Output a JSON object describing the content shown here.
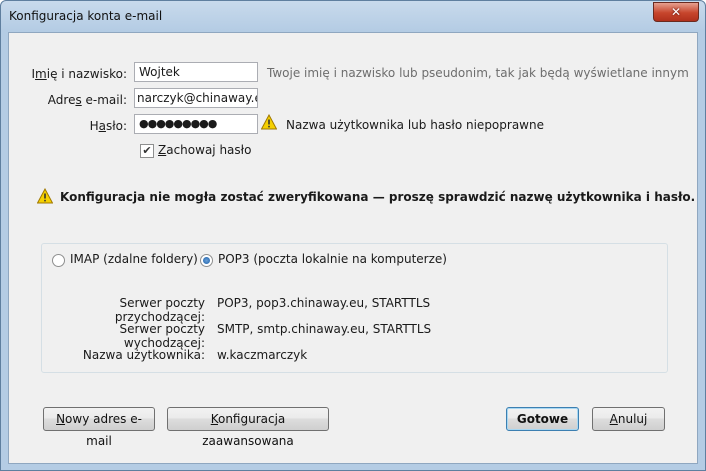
{
  "window": {
    "title": "Konfiguracja konta e-mail",
    "close_symbol": "✕"
  },
  "form": {
    "name_label_pre": "I",
    "name_label_accel": "m",
    "name_label_post": "ię i nazwisko:",
    "name_value": "Wojtek",
    "name_hint": "Twoje imię i nazwisko lub pseudonim, tak jak będą wyświetlane innym",
    "email_label_pre": "Adre",
    "email_label_accel": "s",
    "email_label_post": " e-mail:",
    "email_value": "narczyk@chinaway.eu",
    "password_label_pre": "H",
    "password_label_accel": "a",
    "password_label_post": "sło:",
    "password_value": "●●●●●●●●●",
    "password_error": "Nazwa użytkownika lub hasło niepoprawne",
    "remember_label_pre": "",
    "remember_label_accel": "Z",
    "remember_label_post": "achowaj hasło",
    "remember_checked": true,
    "checkmark": "✔"
  },
  "warning_message": "Konfiguracja nie mogła zostać zweryfikowana — proszę sprawdzić nazwę użytkownika i hasło.",
  "server": {
    "imap_label": "IMAP (zdalne foldery)",
    "pop3_label": "POP3 (poczta lokalnie na komputerze)",
    "selected": "pop3",
    "incoming_label": "Serwer poczty przychodzącej:",
    "incoming_value": "POP3, pop3.chinaway.eu, STARTTLS",
    "outgoing_label": "Serwer poczty wychodzącej:",
    "outgoing_value": "SMTP, smtp.chinaway.eu, STARTTLS",
    "username_label": "Nazwa użytkownika:",
    "username_value": "w.kaczmarczyk"
  },
  "buttons": {
    "new_account_pre": "",
    "new_account_accel": "N",
    "new_account_post": "owy adres e-mail",
    "advanced_pre": "",
    "advanced_accel": "K",
    "advanced_post": "onfiguracja zaawansowana",
    "done": "Gotowe",
    "cancel_pre": "",
    "cancel_accel": "A",
    "cancel_post": "nuluj"
  },
  "colors": {
    "warning": "#f5d000",
    "titlebar": "#b4cce4",
    "close": "#c7452c"
  }
}
